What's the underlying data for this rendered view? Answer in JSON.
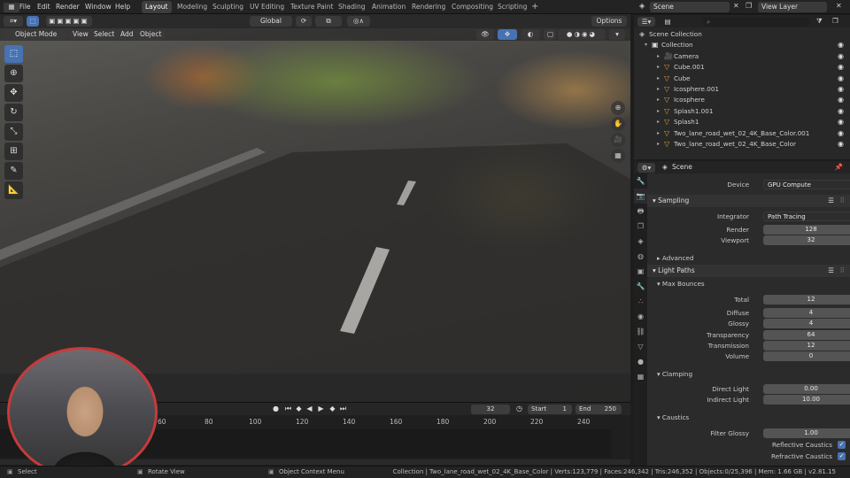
{
  "menu": [
    "File",
    "Edit",
    "Render",
    "Window",
    "Help"
  ],
  "workspaces": [
    "Layout",
    "Modeling",
    "Sculpting",
    "UV Editing",
    "Texture Paint",
    "Shading",
    "Animation",
    "Rendering",
    "Compositing",
    "Scripting"
  ],
  "header": {
    "transform": "Global",
    "options": "Options",
    "scene": "Scene",
    "view_layer": "View Layer"
  },
  "viewport": {
    "mode": "Object Mode",
    "menus": [
      "View",
      "Select",
      "Add",
      "Object"
    ]
  },
  "timeline": {
    "ticks": [
      "60",
      "80",
      "100",
      "120",
      "140",
      "160",
      "180",
      "200",
      "220",
      "240"
    ],
    "current_frame": "32",
    "start_label": "Start",
    "start": "1",
    "end_label": "End",
    "end": "250"
  },
  "outliner": {
    "search_placeholder": "",
    "rows": [
      {
        "label": "Scene Collection",
        "indent": 0
      },
      {
        "label": "Collection",
        "indent": 1
      },
      {
        "label": "Camera",
        "indent": 2
      },
      {
        "label": "Cube.001",
        "indent": 2
      },
      {
        "label": "Cube",
        "indent": 2
      },
      {
        "label": "Icosphere.001",
        "indent": 2
      },
      {
        "label": "Icosphere",
        "indent": 2
      },
      {
        "label": "Splash1.001",
        "indent": 2
      },
      {
        "label": "Splash1",
        "indent": 2
      },
      {
        "label": "Two_lane_road_wet_02_4K_Base_Color.001",
        "indent": 2
      },
      {
        "label": "Two_lane_road_wet_02_4K_Base_Color",
        "indent": 2
      }
    ]
  },
  "properties": {
    "context": "Scene",
    "device_label": "Device",
    "device": "GPU Compute",
    "sampling": "Sampling",
    "integrator_label": "Integrator",
    "integrator": "Path Tracing",
    "render_label": "Render",
    "render": "128",
    "viewport_label": "Viewport",
    "viewport": "32",
    "advanced": "Advanced",
    "light_paths": "Light Paths",
    "max_bounces": "Max Bounces",
    "total_label": "Total",
    "total": "12",
    "diffuse_label": "Diffuse",
    "diffuse": "4",
    "glossy_label": "Glossy",
    "glossy": "4",
    "transparency_label": "Transparency",
    "transparency": "64",
    "transmission_label": "Transmission",
    "transmission": "12",
    "volume_label": "Volume",
    "volume": "0",
    "clamping": "Clamping",
    "direct_label": "Direct Light",
    "direct": "0.00",
    "indirect_label": "Indirect Light",
    "indirect": "10.00",
    "caustics": "Caustics",
    "filter_glossy_label": "Filter Glossy",
    "filter_glossy": "1.00",
    "reflective_label": "Reflective Caustics",
    "refractive_label": "Refractive Caustics"
  },
  "status": {
    "select": "Select",
    "rotate": "Rotate View",
    "context_menu": "Object Context Menu",
    "info": "Collection | Two_lane_road_wet_02_4K_Base_Color | Verts:123,779 | Faces:246,342 | Tris:246,352 | Objects:0/25,396 | Mem: 1.66 GB | v2.81.15"
  }
}
